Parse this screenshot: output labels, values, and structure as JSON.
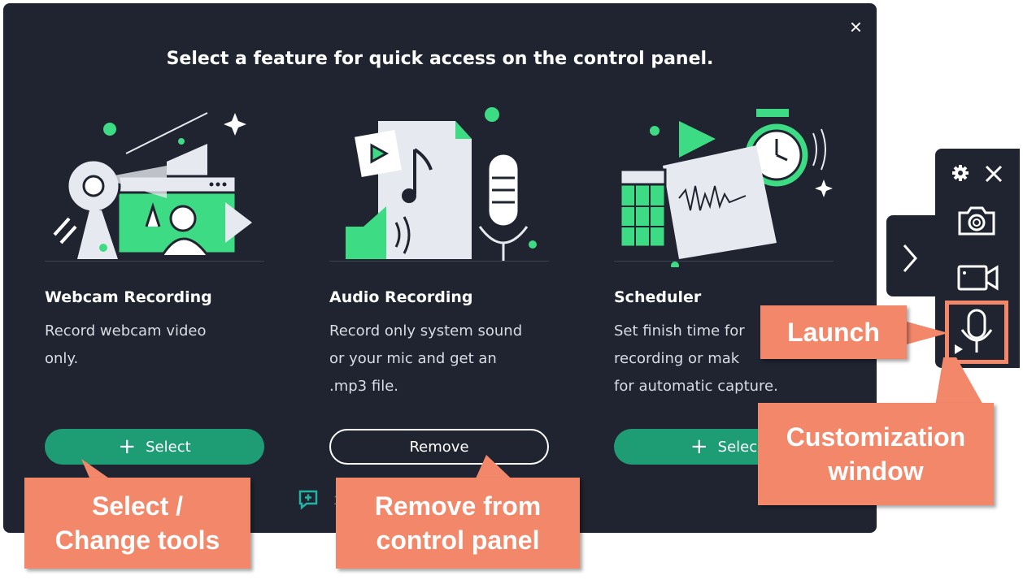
{
  "dialog": {
    "title": "Select a feature for quick access on the control panel.",
    "close_icon": "×"
  },
  "cards": [
    {
      "name": "Webcam Recording",
      "desc": [
        "Record webcam video",
        "only."
      ],
      "button": {
        "icon": "+",
        "label": "Select",
        "style": "select"
      }
    },
    {
      "name": "Audio Recording",
      "desc": [
        "Record only system sound",
        "or your mic and get an",
        ".mp3 file."
      ],
      "button": {
        "label": "Remove",
        "style": "remove"
      }
    },
    {
      "name": "Scheduler",
      "desc": [
        "Set finish time for",
        "recording or mak",
        "for automatic capture."
      ],
      "button": {
        "icon": "+",
        "label": "Selec",
        "style": "select"
      }
    }
  ],
  "feedback": {
    "icon": "chat-plus-icon",
    "link_text": "1"
  },
  "control_panel": {
    "icons": [
      "gear-icon",
      "close-icon",
      "camera-icon",
      "video-camera-icon",
      "microphone-icon",
      "chevron-right-icon"
    ]
  },
  "callouts": {
    "launch": "Launch",
    "customization": [
      "Customization",
      "window"
    ],
    "select_change": [
      "Select /",
      "Change tools"
    ],
    "remove": [
      "Remove from",
      "control panel"
    ]
  },
  "colors": {
    "dialog_bg": "#1f2430",
    "accent_green": "#1e9d74",
    "illustration_green": "#3ddc84",
    "callout_orange": "#f2876a",
    "link_teal": "#22b3a3"
  }
}
